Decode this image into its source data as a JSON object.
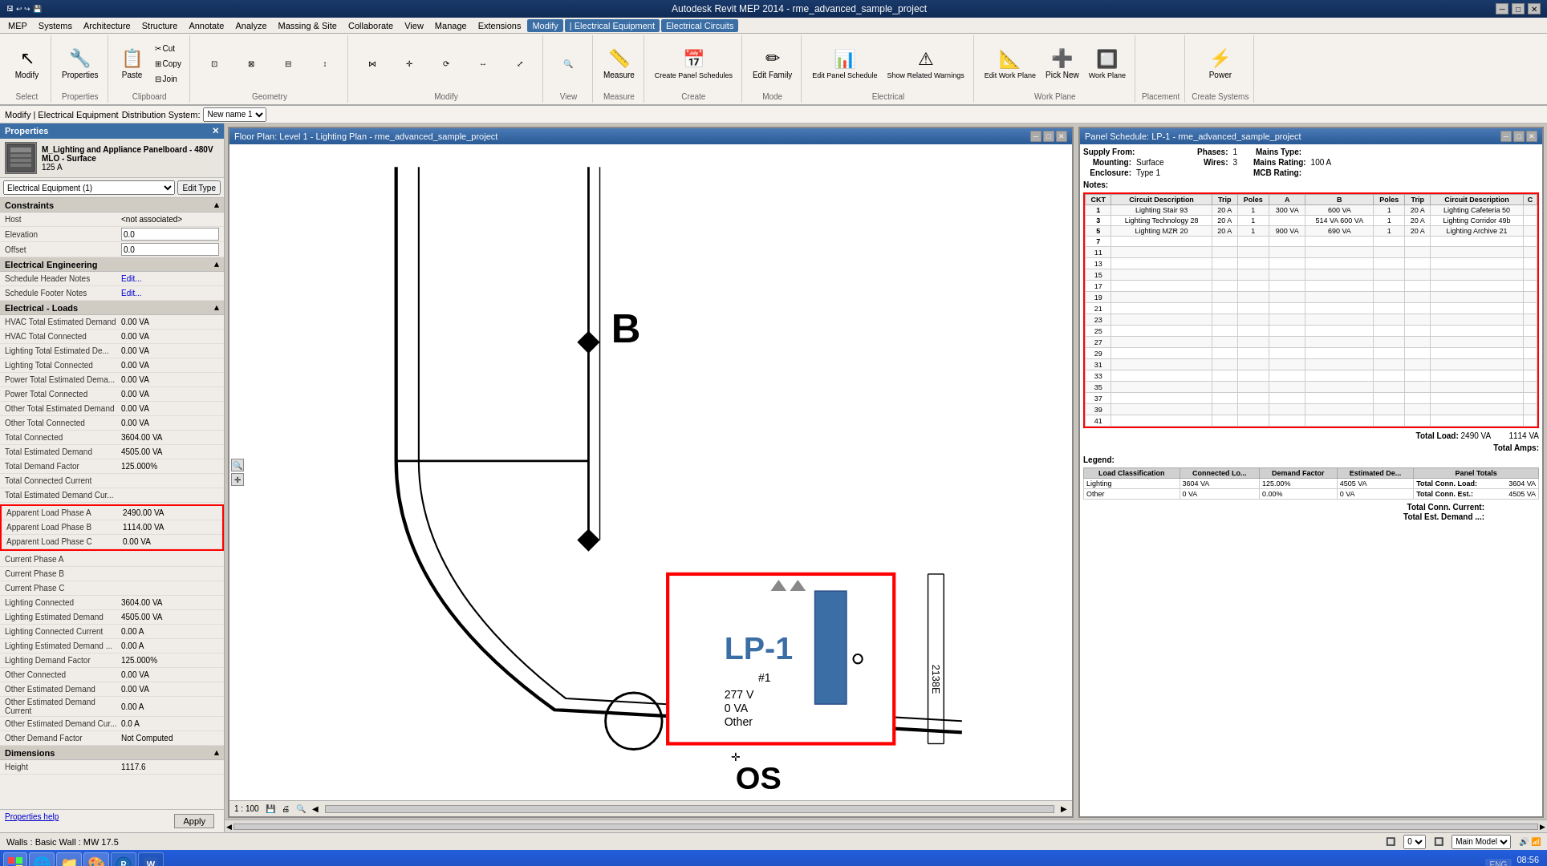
{
  "titleBar": {
    "title": "Autodesk Revit MEP 2014 - rme_advanced_sample_project",
    "controls": [
      "─",
      "□",
      "✕"
    ]
  },
  "menuBar": {
    "items": [
      "MEP",
      "Systems",
      "Architecture",
      "Structure",
      "Annotate",
      "Analyze",
      "Massing & Site",
      "Collaborate",
      "View",
      "Manage",
      "Extensions",
      "Modify",
      "Electrical Equipment",
      "Electrical Circuits"
    ],
    "activeItems": [
      "Modify",
      "Electrical Circuits"
    ]
  },
  "ribbon": {
    "groups": [
      {
        "label": "Select",
        "buttons": [
          {
            "icon": "↖",
            "text": "Modify"
          }
        ]
      },
      {
        "label": "Properties",
        "buttons": [
          {
            "icon": "🔧",
            "text": "Properties"
          }
        ]
      },
      {
        "label": "Clipboard",
        "buttons": [
          {
            "icon": "📋",
            "text": "Paste"
          },
          {
            "icon": "✂",
            "text": "Cut"
          },
          {
            "icon": "⊞",
            "text": "Join"
          }
        ]
      },
      {
        "label": "Geometry",
        "buttons": [
          {
            "icon": "⊡",
            "text": ""
          },
          {
            "icon": "⊠",
            "text": ""
          },
          {
            "icon": "⊟",
            "text": ""
          },
          {
            "icon": "↕",
            "text": ""
          }
        ]
      },
      {
        "label": "Modify",
        "buttons": [
          {
            "icon": "◈",
            "text": ""
          },
          {
            "icon": "⟳",
            "text": ""
          },
          {
            "icon": "↔",
            "text": ""
          },
          {
            "icon": "⤢",
            "text": ""
          }
        ]
      },
      {
        "label": "View",
        "buttons": [
          {
            "icon": "🔍",
            "text": ""
          }
        ]
      },
      {
        "label": "Measure",
        "buttons": [
          {
            "icon": "📏",
            "text": "Measure"
          }
        ]
      },
      {
        "label": "Create",
        "buttons": [
          {
            "icon": "📅",
            "text": "Create Panel Schedules"
          }
        ]
      },
      {
        "label": "Mode",
        "buttons": [
          {
            "icon": "✏",
            "text": "Edit Family"
          }
        ]
      },
      {
        "label": "Electrical",
        "buttons": [
          {
            "icon": "📊",
            "text": "Edit Panel Schedule"
          },
          {
            "icon": "⚠",
            "text": "Show Related Warnings"
          }
        ]
      },
      {
        "label": "Work Plane",
        "buttons": [
          {
            "icon": "📐",
            "text": "Edit Work Plane"
          },
          {
            "icon": "➕",
            "text": "Pick New"
          },
          {
            "icon": "🔲",
            "text": "Work Plane"
          }
        ]
      },
      {
        "label": "Placement",
        "buttons": []
      },
      {
        "label": "Create Systems",
        "buttons": [
          {
            "icon": "⚡",
            "text": "Power"
          }
        ]
      }
    ]
  },
  "breadcrumb": {
    "text": "Modify | Electrical Equipment",
    "distributionSystem": "Distribution System:",
    "distributionValue": "New name 1"
  },
  "properties": {
    "title": "Properties",
    "typeName": "M_Lighting and Appliance Panelboard - 480V MLO - Surface",
    "typeValue": "125 A",
    "selector": "Electrical Equipment (1)",
    "editTypeBtn": "Edit Type",
    "sections": [
      {
        "name": "Constraints",
        "rows": [
          {
            "label": "Host",
            "value": "<not associated>",
            "hasInput": false
          },
          {
            "label": "Elevation",
            "value": "0.0",
            "hasInput": true
          },
          {
            "label": "Offset",
            "value": "0.0",
            "hasInput": true
          }
        ]
      },
      {
        "name": "Electrical Engineering",
        "rows": [
          {
            "label": "Schedule Header Notes",
            "value": "Edit...",
            "hasInput": false
          },
          {
            "label": "Schedule Footer Notes",
            "value": "Edit...",
            "hasInput": false
          }
        ]
      },
      {
        "name": "Electrical - Loads",
        "rows": [
          {
            "label": "HVAC Total Estimated Demand",
            "value": "0.00 VA",
            "hasInput": false
          },
          {
            "label": "HVAC Total Connected",
            "value": "0.00 VA",
            "hasInput": false
          },
          {
            "label": "Lighting Total Estimated De...",
            "value": "0.00 VA",
            "hasInput": false
          },
          {
            "label": "Lighting Total Connected",
            "value": "0.00 VA",
            "hasInput": false
          },
          {
            "label": "Power Total Estimated Dema...",
            "value": "0.00 VA",
            "hasInput": false
          },
          {
            "label": "Power Total Connected",
            "value": "0.00 VA",
            "hasInput": false,
            "highlighted": false
          },
          {
            "label": "Other Total Estimated Demand",
            "value": "0.00 VA",
            "hasInput": false
          },
          {
            "label": "Other Total Connected",
            "value": "0.00 VA",
            "hasInput": false
          },
          {
            "label": "Total Connected",
            "value": "3604.00 VA",
            "hasInput": false
          },
          {
            "label": "Total Estimated Demand",
            "value": "4505.00 VA",
            "hasInput": false
          },
          {
            "label": "Total Demand Factor",
            "value": "125.000%",
            "hasInput": false
          },
          {
            "label": "Total Connected Current",
            "value": "",
            "hasInput": false
          },
          {
            "label": "Total Estimated Demand Cur...",
            "value": "",
            "hasInput": false
          },
          {
            "label": "Apparent Load Phase A",
            "value": "2490.00 VA",
            "hasInput": false,
            "highlighted": true
          },
          {
            "label": "Apparent Load Phase B",
            "value": "1114.00 VA",
            "hasInput": false,
            "highlighted": true
          },
          {
            "label": "Apparent Load Phase C",
            "value": "0.00 VA",
            "hasInput": false,
            "highlighted": true
          },
          {
            "label": "Current Phase A",
            "value": "",
            "hasInput": false
          },
          {
            "label": "Current Phase B",
            "value": "",
            "hasInput": false
          },
          {
            "label": "Current Phase C",
            "value": "",
            "hasInput": false
          },
          {
            "label": "Lighting Connected",
            "value": "3604.00 VA",
            "hasInput": false
          },
          {
            "label": "Lighting Estimated Demand",
            "value": "4505.00 VA",
            "hasInput": false
          },
          {
            "label": "Lighting Connected Current",
            "value": "0.00 A",
            "hasInput": false
          },
          {
            "label": "Lighting Estimated Demand ...",
            "value": "0.00 A",
            "hasInput": false
          },
          {
            "label": "Lighting Demand Factor",
            "value": "125.000%",
            "hasInput": false
          },
          {
            "label": "Other Connected",
            "value": "0.00 VA",
            "hasInput": false
          },
          {
            "label": "Other Estimated Demand",
            "value": "0.00 VA",
            "hasInput": false
          },
          {
            "label": "Other Estimated Demand Current",
            "value": "0.00 A",
            "hasInput": false
          },
          {
            "label": "Other Estimated Demand Cur...",
            "value": "0.0 A",
            "hasInput": false
          },
          {
            "label": "Other Demand Factor",
            "value": "Not Computed",
            "hasInput": false
          }
        ]
      },
      {
        "name": "Dimensions",
        "rows": [
          {
            "label": "Height",
            "value": "1117.6",
            "hasInput": false
          }
        ]
      }
    ],
    "applyBtn": "Apply",
    "helpLink": "Properties help"
  },
  "floorPlan": {
    "title": "Floor Plan: Level 1 - Lighting Plan - rme_advanced_sample_project",
    "scale": "1 : 100",
    "lp1Label": "LP-1",
    "lp1Circuit": "#1",
    "lp1Phase": "277 V",
    "lp1VA": "0 VA",
    "lp1Other": "Other"
  },
  "panelSchedule": {
    "title": "Panel Schedule: LP-1 - rme_advanced_sample_project",
    "supplyFrom": "Supply From:",
    "phases": "Phases:",
    "phasesValue": "1",
    "mainsType": "Mains Type:",
    "mounting": "Mounting:",
    "mountingValue": "Surface",
    "wires": "Wires:",
    "wiresValue": "3",
    "mainsRating": "Mains Rating:",
    "mainsRatingValue": "100 A",
    "enclosure": "Enclosure:",
    "enclosureValue": "Type 1",
    "mcbRating": "MCB Rating:",
    "notes": "Notes:",
    "tableHeaders": [
      "CKT",
      "Circuit Description",
      "Trip",
      "Poles",
      "A",
      "B",
      "Poles",
      "Trip",
      "Circuit Description",
      "C"
    ],
    "circuits": [
      {
        "ckt": "1",
        "desc": "Lighting Stair 93",
        "trip": "20 A",
        "poles": "1",
        "a": "300 VA",
        "b": "600 VA",
        "polesR": "1",
        "tripR": "20 A",
        "descR": "Lighting Cafeteria 50",
        "c": ""
      },
      {
        "ckt": "3",
        "desc": "Lighting Technology 28",
        "trip": "20 A",
        "poles": "1",
        "a": "",
        "b": "514 VA",
        "c2": "600 VA",
        "polesR": "1",
        "tripR": "20 A",
        "descR": "Lighting Corridor 49b",
        "c": ""
      },
      {
        "ckt": "5",
        "desc": "Lighting MZR 20",
        "trip": "20 A",
        "poles": "1",
        "a": "900 VA",
        "b": "690 VA",
        "polesR": "1",
        "tripR": "20 A",
        "descR": "Lighting Archive 21",
        "c": ""
      },
      {
        "ckt": "7",
        "desc": "",
        "trip": "",
        "poles": "",
        "a": "",
        "b": "",
        "polesR": "",
        "tripR": "",
        "descR": "",
        "c": ""
      }
    ],
    "emptyRows": [
      "11",
      "13",
      "15",
      "17",
      "19",
      "21",
      "23",
      "25",
      "27",
      "29",
      "31",
      "33",
      "35",
      "37",
      "39",
      "41"
    ],
    "totalLoad": "Total Load:",
    "totalLoadA": "2490 VA",
    "totalLoadB": "1114 VA",
    "totalAmps": "Total Amps:",
    "legend": "Legend:",
    "loadTable": {
      "headers": [
        "Load Classification",
        "Connected Lo...",
        "Demand Factor",
        "Estimated De...",
        "Panel Totals"
      ],
      "rows": [
        {
          "class": "Lighting",
          "connected": "3604 VA",
          "factor": "125.00%",
          "estimated": "4505 VA",
          "totalsLabel": "Total Conn. Load:",
          "totalsValue": "3604 VA"
        },
        {
          "class": "Other",
          "connected": "0 VA",
          "factor": "0.00%",
          "estimated": "0 VA",
          "totalsLabel": "Total Conn. Est.:",
          "totalsValue": "4505 VA"
        }
      ],
      "extraTotals": [
        {
          "label": "Total Conn. Current:",
          "value": ""
        },
        {
          "label": "Total Est. Demand ...:",
          "value": ""
        }
      ]
    }
  },
  "statusBar": {
    "text": "Walls : Basic Wall : MW 17.5",
    "scale": "0",
    "model": "Main Model"
  },
  "taskbar": {
    "startBtn": "⊞",
    "buttons": [
      "🌐",
      "📁",
      "🎨",
      "💠",
      "🔵",
      "W"
    ],
    "clock": "08:56\n↑↓1/1↑"
  }
}
